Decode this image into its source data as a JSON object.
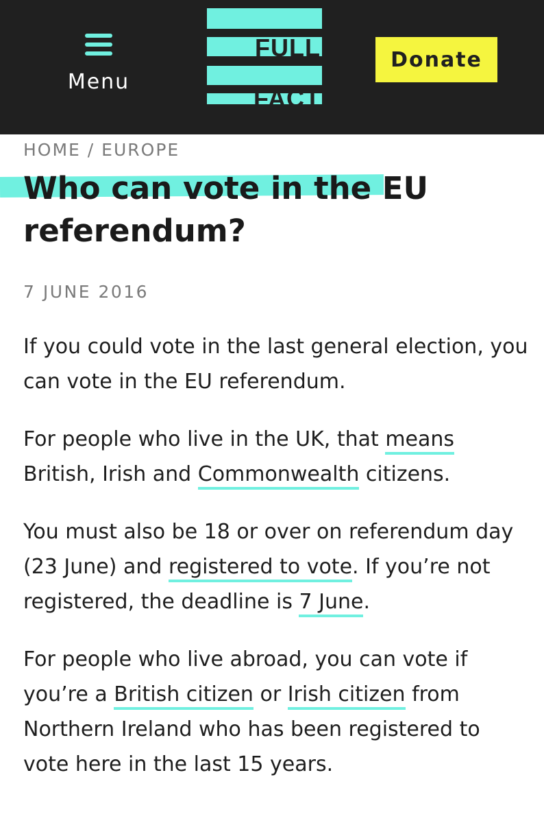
{
  "header": {
    "menu_label": "Menu",
    "menu_icon": "hamburger-icon",
    "logo_top": "FULL",
    "logo_bottom": "FACT",
    "donate_label": "Donate",
    "colors": {
      "background": "#202020",
      "accent": "#70f0e0",
      "donate": "#f5f53f"
    }
  },
  "breadcrumb": {
    "home": "HOME",
    "separator": " / ",
    "section": "EUROPE"
  },
  "article": {
    "title": "Who can vote in the EU referendum?",
    "date": "7 JUNE 2016",
    "p1": "If you could vote in the last general election, you can vote in the EU referendum.",
    "p2": {
      "t1": "For people who live in the UK, that ",
      "link1": "means",
      "t2": " British, Irish and ",
      "link2": "Commonwealth",
      "t3": " citizens."
    },
    "p3": {
      "t1": "You must also be 18 or over on referendum day (23 June) and ",
      "link1": "registered to vote",
      "t2": ". If you’re not registered, the deadline is ",
      "link2": "7 June",
      "t3": "."
    },
    "p4": {
      "t1": "For people who live abroad, you can vote if you’re a ",
      "link1": "British citizen",
      "t2": " or ",
      "link2": "Irish citizen",
      "t3": " from Northern Ireland who has been registered to vote here in the last 15 years."
    }
  }
}
